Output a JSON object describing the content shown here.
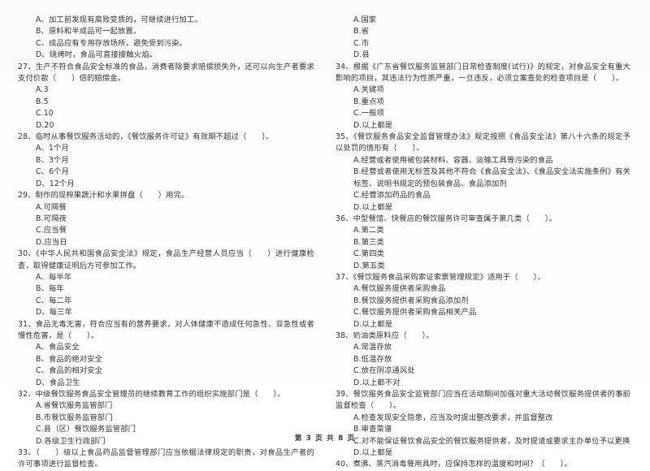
{
  "document": {
    "type": "exam-paper",
    "language": "zh-CN",
    "footer": "第 3 页 共 8 页",
    "page_number": "3",
    "total_pages": "8"
  },
  "left_column": {
    "orphan_options": [
      "A、加工前发现有腐败变质的，可继续进行加工。",
      "B、原料和半成品可一起放置。",
      "C、成品应有专用存放场所，避免受到污染。",
      "D、烧烤时，食品可直接接触火焰。"
    ],
    "questions": [
      {
        "number": "27",
        "stem": "27、生产不符合食品安全标准的食品，消费者除要求赔偿损失外，还可以向生产者要求支付价款（　　）倍的赔偿金。",
        "options": [
          "A.3",
          "B.5",
          "C.10",
          "D.20"
        ]
      },
      {
        "number": "28",
        "stem": "28、临时从事餐饮服务活动的，《餐饮服务许可证》有效期不超过（　　）。",
        "options": [
          "A、1个月",
          "B、3个月",
          "C、6个月",
          "D、12个月"
        ]
      },
      {
        "number": "29",
        "stem": "29、制作的现榨果蔬汁和水果拼盘（　　）用完。",
        "options": [
          "A.可隔餐",
          "B.可隔夜",
          "C.应当餐",
          "D.应当日"
        ]
      },
      {
        "number": "30",
        "stem": "30、《中华人民共和国食品安全法》规定，食品生产经营人员应当（　　）进行健康检查，取得健康证明后方可参加工作。",
        "options": [
          "A、每半年",
          "B、每年",
          "C、每二年",
          "D、每三年"
        ]
      },
      {
        "number": "31",
        "stem": "31、食品无毒无害，符合应当有的营养要求，对人体健康不造成任何急性、亚急性或者慢性危害，是（　　）。",
        "options": [
          "A、食品安全",
          "B、食品的绝对安全",
          "C、食品的相对安全",
          "D、食品卫生"
        ]
      },
      {
        "number": "32",
        "stem": "32、中级餐饮服务食品安全管理员的继续教育工作的组织实施部门是（　　）。",
        "options": [
          "A.省餐饮服务监管部门",
          "B.市餐饮服务监管部门",
          "C.县（区）餐饮服务监管部门",
          "D.各级卫生行政部门"
        ]
      },
      {
        "number": "33",
        "stem": "33、（　　）级以上食品药品监督管理部门应当依据法律规定的职责，对食品生产者的许可事项进行监督检查。",
        "options": []
      }
    ]
  },
  "right_column": {
    "orphan_options": [
      "A.国家",
      "B.省",
      "C.市",
      "D.县"
    ],
    "questions": [
      {
        "number": "34",
        "stem": "34、根据《广东省餐饮服务监管部门日常检查制度(试行)》的规定，对食品安全有重大影响的项目，其违法行为性质严重，一旦违反，必须立案查处的检查项目是（　　）。",
        "options": [
          "A.关键项",
          "B.重点项",
          "C.一般项",
          "D.以上都是"
        ]
      },
      {
        "number": "35",
        "stem": "35、《餐饮服务食品安全监督管理办法》规定按照《食品安全法》第八十六条的规定予以处罚的情形有（　　）。",
        "options": [
          "A.经营或者使用被包装材料、容器、运输工具等污染的食品",
          "B.经营或者使用无标签及其他不符合《食品安全法》、《食品安全法实施条例》有关标签、说明书规定的预包装食品、食品添加剂",
          "C.经营添加药品的食品",
          "D.以上都是"
        ]
      },
      {
        "number": "36",
        "stem": "36、中型餐馆、快餐店的餐饮服务许可审查属于第几类（　　）。",
        "options": [
          "A.第二类",
          "B.第三类",
          "C.第四类",
          "D.第五类"
        ]
      },
      {
        "number": "37",
        "stem": "37、《餐饮服务食品采购索证索票管理规定》适用于（　　）。",
        "options": [
          "A.餐饮服务提供者采购食品",
          "B.餐饮服务提供者采购食品添加剂",
          "C.餐饮服务提供者采购食品相关产品",
          "D.以上都是"
        ]
      },
      {
        "number": "38",
        "stem": "38、奶油类原料应（　　）。",
        "options": [
          "A.常温存放",
          "B.低温存放",
          "C.放在阴凉通风处",
          "D.以上都不对"
        ]
      },
      {
        "number": "39",
        "stem": "39、餐饮服务食品安全监管部门应当在活动期间加强对重大活动餐饮服务提供者的事前监督检查（　　）。",
        "options": [
          "A.检查发现安全隐患，应当及时提出整改要求，并监督整改",
          "B.审查菜谱",
          "C.对不能保证餐饮食品安全的餐饮服务提供者，及时提请或要求主办单位予以更换",
          "D.以上都是"
        ]
      },
      {
        "number": "40",
        "stem": "40、煮沸、蒸汽消毒餐用具时，应保持怎样的温度和时间？（　　）。",
        "options": []
      }
    ]
  }
}
